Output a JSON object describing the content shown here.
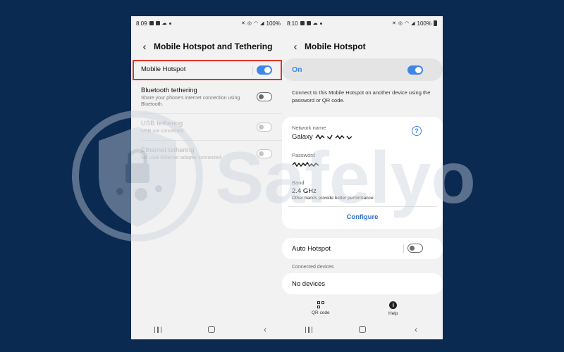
{
  "left_screen": {
    "status": {
      "time": "8:09",
      "battery": "100%"
    },
    "title": "Mobile Hotspot and Tethering",
    "items": [
      {
        "label": "Mobile Hotspot",
        "sublabel": "",
        "state": "on"
      },
      {
        "label": "Bluetooth tethering",
        "sublabel": "Share your phone's internet connection using Bluetooth.",
        "state": "off"
      },
      {
        "label": "USB tethering",
        "sublabel": "USB not connected",
        "state": "off-disabled"
      },
      {
        "label": "Ethernet tethering",
        "sublabel": "No USB Ethernet adapter connected",
        "state": "off-disabled"
      }
    ]
  },
  "right_screen": {
    "status": {
      "time": "8:10",
      "battery": "100%"
    },
    "title": "Mobile Hotspot",
    "master_toggle": {
      "label": "On",
      "state": "on"
    },
    "description": "Connect to this Mobile Hotspot on another device using the password or QR code.",
    "network": {
      "name_label": "Network name",
      "name_value": "Galaxy",
      "password_label": "Password",
      "band_label": "Band",
      "band_value": "2.4 GHz",
      "band_note": "Other bands provide better performance.",
      "configure_label": "Configure"
    },
    "auto_hotspot": {
      "label": "Auto Hotspot",
      "state": "off"
    },
    "connected_devices": {
      "header": "Connected devices",
      "empty": "No devices"
    },
    "bottom_actions": {
      "qr": "QR code",
      "help": "Help"
    }
  },
  "watermark": {
    "text": "Safelyo"
  },
  "colors": {
    "background": "#0b2a52",
    "accent": "#3e87e6",
    "highlight": "#e23226"
  }
}
